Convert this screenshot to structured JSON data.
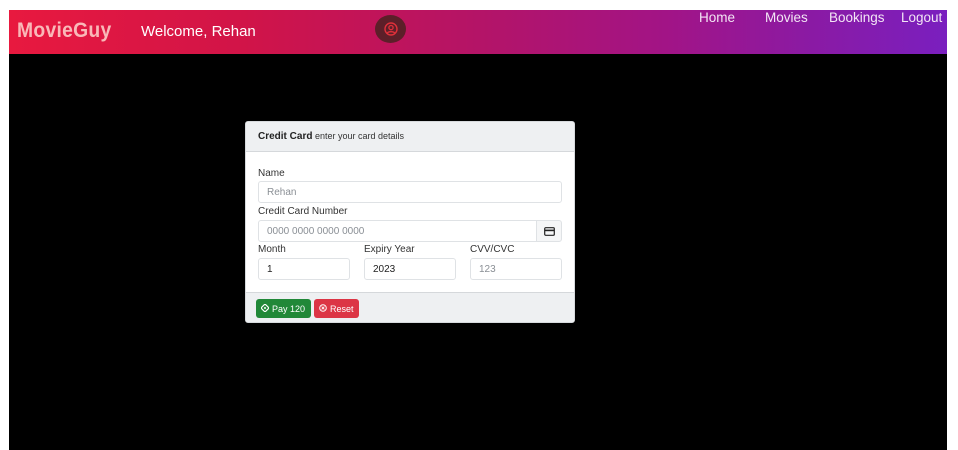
{
  "navbar": {
    "brand": "MovieGuy",
    "welcome": "Welcome, Rehan",
    "links": [
      "Home",
      "Movies",
      "Bookings",
      "Logout"
    ]
  },
  "card": {
    "title": "Credit Card",
    "subtitle": "enter your card details",
    "name_label": "Name",
    "name_value": "Rehan",
    "number_label": "Credit Card Number",
    "number_placeholder": "0000 0000 0000 0000",
    "month_label": "Month",
    "month_value": "1",
    "year_label": "Expiry Year",
    "year_value": "2023",
    "cvv_label": "CVV/CVC",
    "cvv_placeholder": "123",
    "pay_label": "Pay 120",
    "reset_label": "Reset"
  },
  "icons": {
    "avatar": "user-circle-icon",
    "card": "credit-card-icon",
    "pay": "gem-icon",
    "reset": "circle-x-icon"
  },
  "colors": {
    "navbar_start": "#e8193f",
    "navbar_end": "#7a1fbf",
    "pay_button": "#218838",
    "reset_button": "#dc3545",
    "background": "#000000"
  }
}
